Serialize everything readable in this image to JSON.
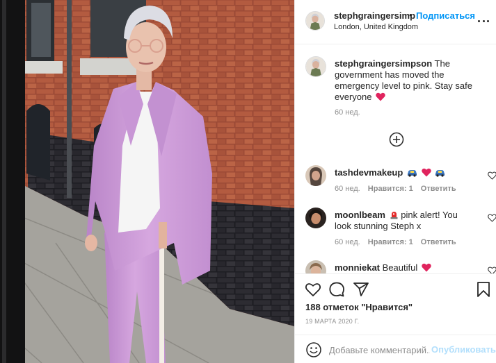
{
  "header": {
    "username": "stephgraingersimp",
    "separator": "•",
    "follow_label": "Подписаться",
    "location": "London, United Kingdom"
  },
  "caption": {
    "username": "stephgraingersimpson",
    "text": "The government has moved the emergency level to pink. Stay safe everyone",
    "time": "60 нед."
  },
  "comments": [
    {
      "username": "tashdevmakeup",
      "text": "",
      "time": "60 нед.",
      "likes": "Нравится: 1",
      "reply": "Ответить",
      "emoji": [
        "car",
        "heart",
        "car"
      ]
    },
    {
      "username": "moonlbeam",
      "text": "pink alert! You look stunning Steph x",
      "time": "60 нед.",
      "likes": "Нравится: 1",
      "reply": "Ответить",
      "emoji": [
        "siren"
      ]
    },
    {
      "username": "monniekat",
      "text": "Beautiful",
      "time": "",
      "likes": "",
      "reply": "",
      "emoji": [
        "heart"
      ]
    }
  ],
  "actions": {
    "likes_text": "188 отметок \"Нравится\"",
    "date": "19 МАРТА 2020 Г.",
    "comment_placeholder": "Добавьте комментарий...",
    "publish_label": "Опубликовать"
  },
  "icons": {
    "more": "more-options-icon",
    "load_more": "plus-circle-icon",
    "like": "heart-icon",
    "comment": "comment-icon",
    "share": "paper-plane-icon",
    "save": "bookmark-icon",
    "emoji": "smiley-icon"
  },
  "colors": {
    "link_blue": "#0095f6",
    "publish_disabled": "#b2dffc",
    "meta_gray": "#8e8e8e",
    "border": "#efefef",
    "heart_red": "#e0245e"
  }
}
